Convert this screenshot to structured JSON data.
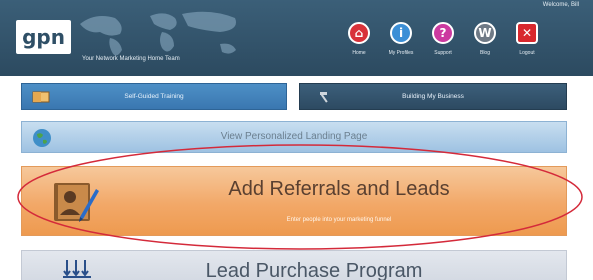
{
  "header": {
    "logo": "gpn",
    "tagline": "Your Network Marketing Home Team",
    "welcome": "Welcome, Bill",
    "nav": [
      {
        "label": "Home",
        "icon": "home-icon",
        "color": "#d8323a",
        "glyph": "⌂"
      },
      {
        "label": "My Profiles",
        "icon": "profile-icon",
        "color": "#3c8fd6",
        "glyph": "i"
      },
      {
        "label": "Support",
        "icon": "support-icon",
        "color": "#cc3aa0",
        "glyph": "?"
      },
      {
        "label": "Blog",
        "icon": "wordpress-icon",
        "color": "#6f7a86",
        "glyph": "W"
      },
      {
        "label": "Logout",
        "icon": "logout-icon",
        "color": "#d8282e",
        "glyph": "✕"
      }
    ]
  },
  "buttons": {
    "self_guided": "Self-Guided Training",
    "building": "Building My Business"
  },
  "landing": {
    "label": "View Personalized Landing Page"
  },
  "referrals": {
    "title": "Add Referrals and Leads",
    "subtitle": "Enter people into your marketing funnel"
  },
  "lead_purchase": {
    "title": "Lead Purchase Program"
  },
  "colors": {
    "header": "#34556d",
    "annotation": "#d42a3a",
    "orange": "#f2a868"
  }
}
